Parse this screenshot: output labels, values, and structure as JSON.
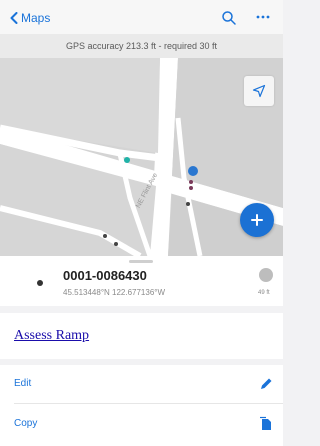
{
  "nav": {
    "back_label": "Maps"
  },
  "gps_banner": {
    "text": "GPS accuracy 213.3 ft - required 30 ft"
  },
  "map": {
    "street_label": "NE Flint Ave"
  },
  "feature": {
    "id": "0001-0086430",
    "coordinates": "45.513448°N 122.677136°W",
    "distance": "49 ft"
  },
  "link": {
    "label": "Assess Ramp"
  },
  "actions": {
    "edit_label": "Edit",
    "copy_label": "Copy"
  },
  "colors": {
    "accent": "#1a73d9",
    "fab": "#1b71d4",
    "link": "#1a0dab"
  }
}
